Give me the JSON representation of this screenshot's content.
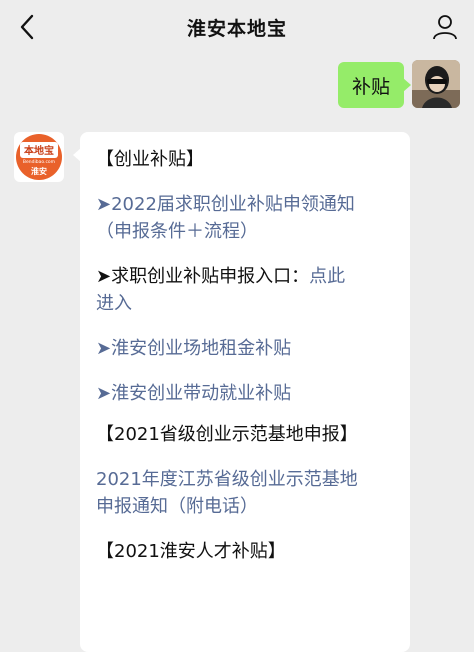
{
  "header": {
    "title": "淮安本地宝"
  },
  "outgoing": {
    "text": "补贴"
  },
  "bot": {
    "logo_top": "本地宝",
    "logo_sub": "Bendibao.com",
    "logo_city": "淮安"
  },
  "reply": {
    "h1": "【创业补贴】",
    "l1": "➤2022届求职创业补贴申领通知",
    "l1b": "（申报条件＋流程）",
    "l2a": "➤求职创业补贴申报入口：",
    "l2link": "点此",
    "l2b": "进入",
    "l3": "➤淮安创业场地租金补贴",
    "l4": "➤淮安创业带动就业补贴",
    "h2": "【2021省级创业示范基地申报】",
    "l5": "2021年度江苏省级创业示范基地",
    "l5b": "申报通知（附电话）",
    "h3": "【2021淮安人才补贴】"
  },
  "colors": {
    "link": "#576b95",
    "bubble_out": "#95ec69",
    "bg": "#ededed",
    "logo": "#e9612a"
  },
  "icons": {
    "back": "back-arrow-icon",
    "profile": "person-icon"
  }
}
